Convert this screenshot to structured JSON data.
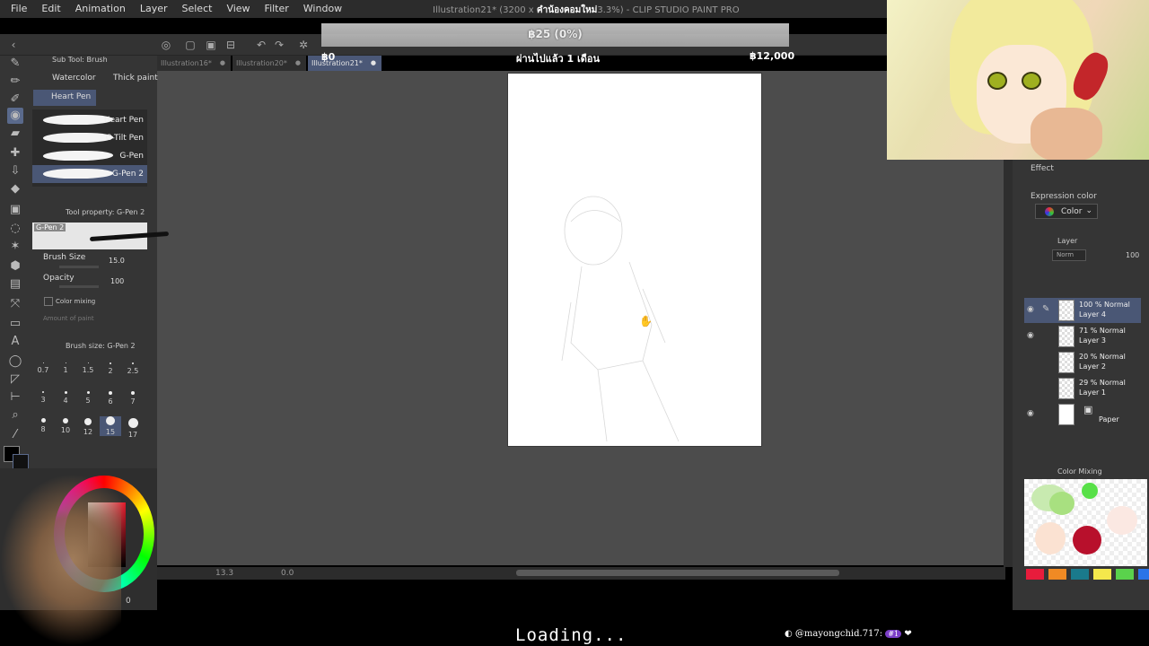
{
  "menu": [
    "File",
    "Edit",
    "Animation",
    "Layer",
    "Select",
    "View",
    "Filter",
    "Window"
  ],
  "window_title_left": "Illustration21* (3200 x",
  "window_title_overlay": "คำน้องคอมใหม่",
  "window_title_right": "3.3%) - CLIP STUDIO PAINT PRO",
  "donation": {
    "amount": "฿25 (0%)",
    "start": "฿0",
    "period": "ผ่านไปแล้ว 1 เดือน",
    "goal": "฿12,000",
    "progress_percent": 0
  },
  "tabs": [
    {
      "label": "Illustration16*"
    },
    {
      "label": "Illustration20*"
    },
    {
      "label": "Illustration21*"
    }
  ],
  "subtool": {
    "header": "Sub Tool: Brush",
    "tabs": [
      "Watercolor",
      "Thick paint",
      "Heart Pen"
    ],
    "brushes": [
      "Heart Pen",
      "G-Tilt Pen",
      "G-Pen",
      "G-Pen 2"
    ]
  },
  "toolprop": {
    "header": "Tool property: G-Pen 2",
    "preview_name": "G-Pen 2",
    "brush_size_label": "Brush Size",
    "brush_size_value": "15.0",
    "opacity_label": "Opacity",
    "opacity_value": "100",
    "color_mixing_label": "Color mixing",
    "amount_of_paint_label": "Amount of paint"
  },
  "brushsize": {
    "header": "Brush size: G-Pen 2",
    "sizes": [
      "0.7",
      "1",
      "1.5",
      "2",
      "2.5",
      "3",
      "4",
      "5",
      "6",
      "7",
      "8",
      "10",
      "12",
      "15",
      "17"
    ]
  },
  "canvas": {
    "zoom": "13.3",
    "angle": "0.0"
  },
  "color_bottom_value": "0",
  "right": {
    "effect_label": "Effect",
    "expression_color_label": "Expression color",
    "expression_color_value": "Color",
    "layer_header": "Layer",
    "blend_mode": "Norm",
    "opacity": "100",
    "layers": [
      {
        "mode": "100 % Normal",
        "name": "Layer 4"
      },
      {
        "mode": "71 % Normal",
        "name": "Layer 3"
      },
      {
        "mode": "20 % Normal",
        "name": "Layer 2"
      },
      {
        "mode": "29 % Normal",
        "name": "Layer 1"
      }
    ],
    "paper_label": "Paper",
    "color_mixing_header": "Color Mixing",
    "swatches": [
      "#e81c3c",
      "#f08a24",
      "#1a7a8c",
      "#f4e84c",
      "#5ad24c",
      "#2a74e8"
    ]
  },
  "overlay": {
    "loading": "Loading...",
    "chat_user": "@mayongchid.717:",
    "chat_badge": "#1"
  }
}
